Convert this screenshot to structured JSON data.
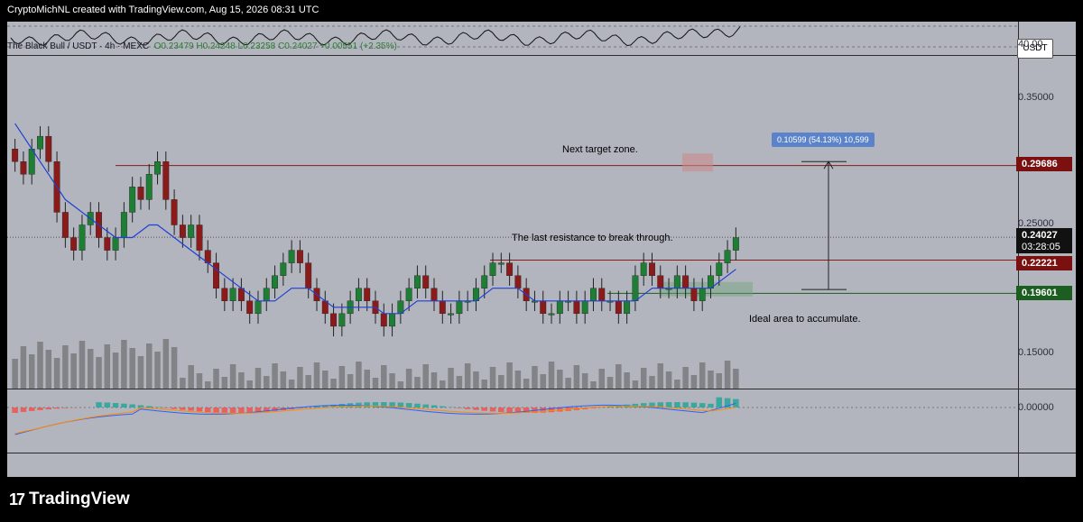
{
  "header": {
    "credit": "CryptoMichNL created with TradingView.com, Aug 15, 2026 08:31 UTC"
  },
  "symbol_line": {
    "title": "The Black Bull / USDT · 4h · MEXC",
    "open": "O0.23479",
    "high": "H0.24248",
    "low": "L0.23258",
    "close": "C0.24027",
    "change": "+0.00551 (+2.35%)"
  },
  "currency_button": "USDT",
  "rsi_pane": {
    "level_label": "40.00"
  },
  "macd_pane": {
    "zero_label": "0.00000"
  },
  "price_axis": {
    "ticks": [
      "0.35000",
      "0.25000",
      "0.15000"
    ]
  },
  "price_tags": {
    "target": {
      "value": "0.29686",
      "color": "#7b1010"
    },
    "last": {
      "value": "0.24027",
      "countdown": "03:28:05",
      "color": "#111111"
    },
    "resistance": {
      "value": "0.22221",
      "color": "#7b1010"
    },
    "support": {
      "value": "0.19601",
      "color": "#1b5e20"
    }
  },
  "annotations": {
    "target_zone": "Next target zone.",
    "resistance": "The last resistance to break through.",
    "accumulate": "Ideal area to accumulate.",
    "measure": "0.10599 (54.13%) 10,599"
  },
  "brand": {
    "logo_mark": "17",
    "name": "TradingView"
  },
  "colors": {
    "up": "#1e7e34",
    "down": "#8b1a1a",
    "ma": "#1f3fd6",
    "macd_line": "#2962ff",
    "signal_line": "#ff8a00"
  },
  "chart_data": {
    "type": "line",
    "title": "The Black Bull / USDT · 4h · MEXC",
    "xlabel": "",
    "ylabel": "",
    "ylim": [
      0.12,
      0.37
    ],
    "series": [
      {
        "values": [
          0.3,
          0.29,
          0.31,
          0.32,
          0.3,
          0.26,
          0.24,
          0.23,
          0.25,
          0.26,
          0.24,
          0.23,
          0.24,
          0.26,
          0.28,
          0.27,
          0.29,
          0.3,
          0.27,
          0.25,
          0.24,
          0.25,
          0.23,
          0.22,
          0.2,
          0.19,
          0.2,
          0.19,
          0.18,
          0.19,
          0.2,
          0.21,
          0.22,
          0.23,
          0.22,
          0.2,
          0.19,
          0.18,
          0.17,
          0.18,
          0.19,
          0.2,
          0.19,
          0.18,
          0.17,
          0.18,
          0.19,
          0.2,
          0.21,
          0.2,
          0.19,
          0.18,
          0.18,
          0.19,
          0.19,
          0.2,
          0.21,
          0.22,
          0.22,
          0.21,
          0.2,
          0.19,
          0.19,
          0.18,
          0.18,
          0.19,
          0.19,
          0.18,
          0.19,
          0.2,
          0.19,
          0.19,
          0.18,
          0.19,
          0.21,
          0.22,
          0.21,
          0.2,
          0.2,
          0.21,
          0.2,
          0.19,
          0.2,
          0.21,
          0.22,
          0.23,
          0.24
        ]
      },
      {
        "values": [
          0.33,
          0.32,
          0.31,
          0.3,
          0.29,
          0.28,
          0.27,
          0.265,
          0.26,
          0.255,
          0.25,
          0.245,
          0.24,
          0.24,
          0.24,
          0.245,
          0.25,
          0.25,
          0.245,
          0.24,
          0.235,
          0.23,
          0.225,
          0.22,
          0.215,
          0.21,
          0.205,
          0.2,
          0.195,
          0.19,
          0.19,
          0.19,
          0.195,
          0.2,
          0.2,
          0.2,
          0.195,
          0.19,
          0.185,
          0.185,
          0.185,
          0.185,
          0.185,
          0.185,
          0.18,
          0.18,
          0.18,
          0.185,
          0.19,
          0.19,
          0.19,
          0.19,
          0.19,
          0.19,
          0.19,
          0.19,
          0.195,
          0.2,
          0.2,
          0.2,
          0.2,
          0.195,
          0.19,
          0.19,
          0.19,
          0.19,
          0.19,
          0.19,
          0.19,
          0.19,
          0.19,
          0.19,
          0.19,
          0.19,
          0.19,
          0.195,
          0.2,
          0.2,
          0.2,
          0.2,
          0.2,
          0.2,
          0.2,
          0.2,
          0.205,
          0.21,
          0.215
        ]
      }
    ],
    "levels": [
      0.29686,
      0.22221,
      0.19601
    ],
    "last_price": 0.24027
  }
}
